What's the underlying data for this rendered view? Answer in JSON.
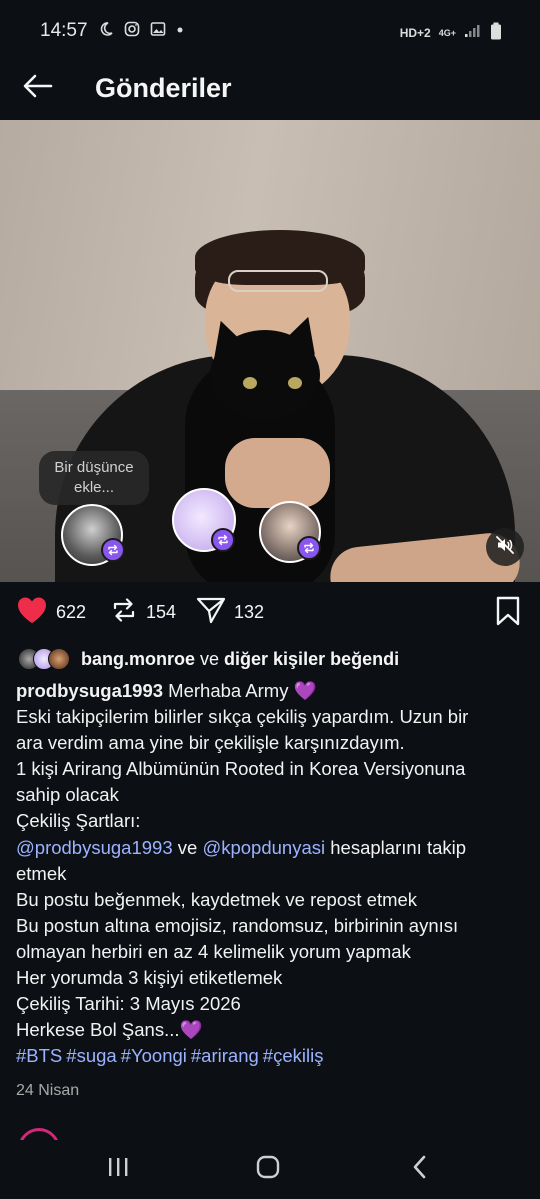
{
  "status_bar": {
    "time": "14:57",
    "network": "HD+2",
    "signal_type": "4G+"
  },
  "header": {
    "title": "Gönderiler"
  },
  "media": {
    "thought_prompt": "Bir düşünce ekle..."
  },
  "actions": {
    "like_count": "622",
    "repost_count": "154",
    "share_count": "132",
    "like_color": "#ed2d49"
  },
  "likes": {
    "user": "bang.monroe",
    "connector": " ve ",
    "others": "diğer kişiler beğendi"
  },
  "caption": {
    "username": "prodbysuga1993",
    "first_line_text": "Merhaba Army 💜",
    "lines": [
      "Eski takipçilerim bilirler sıkça çekiliş yapardım. Uzun bir",
      "ara verdim ama yine bir çekilişle karşınızdayım.",
      "1 kişi Arirang Albümünün Rooted in Korea Versiyonuna",
      "sahip olacak",
      "Çekiliş Şartları:"
    ],
    "mention1": "@prodbysuga1993",
    "mention_connector": " ve ",
    "mention2": "@kpopdunyasi",
    "mention_suffix": " hesaplarını takip",
    "lines_after": [
      "etmek",
      "Bu postu beğenmek, kaydetmek ve repost etmek",
      "Bu postun altına emojisiz, randomsuz, birbirinin aynısı",
      "olmayan herbiri en az 4 kelimelik yorum yapmak",
      "Her yorumda 3 kişiyi etiketlemek",
      "Çekiliş Tarihi: 3 Mayıs 2026",
      "Herkese Bol Şans...💜"
    ],
    "hashtags": [
      "#BTS",
      "#suga",
      "#Yoongi",
      "#arirang",
      "#çekiliş"
    ]
  },
  "date": "24 Nisan",
  "accent_color": "#9bb3ff"
}
